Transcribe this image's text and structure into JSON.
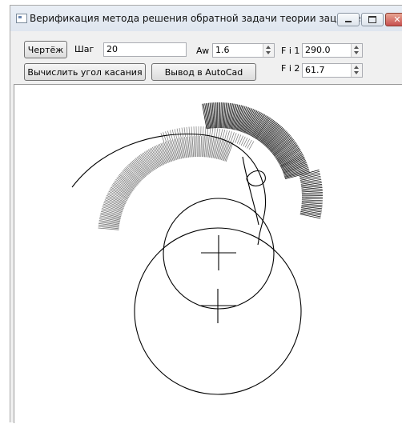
{
  "window": {
    "title": "Верификация метода решения обратной задачи теории зацепления",
    "icon": "app-window-icon"
  },
  "toolbar": {
    "draw_button": "Чертёж",
    "step_label": "Шаг",
    "step_value": "20",
    "aw_label": "Aw",
    "aw_value": "1.6",
    "fi1_label": "F i 1",
    "fi1_value": "290.0",
    "fi2_label": "F i 2",
    "fi2_value": "61.7",
    "calc_button": "Вычислить угол касания",
    "autocad_button": "Вывод в AutoCad"
  },
  "canvas": {
    "description_icon": "drawing-canvas",
    "stroke_color": "#000000",
    "hatch_color": "#777777"
  }
}
